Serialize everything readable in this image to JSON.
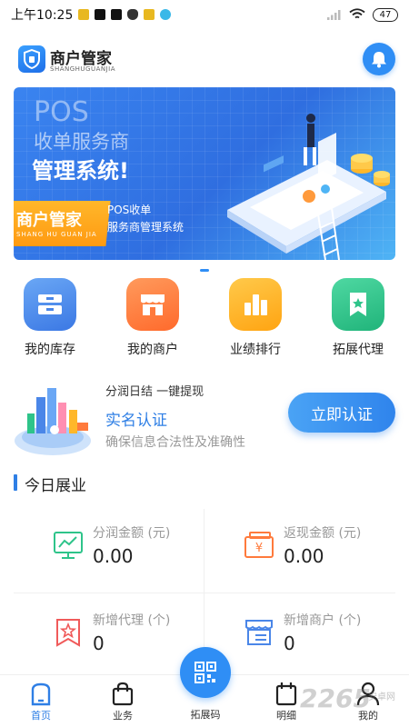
{
  "status_bar": {
    "time": "上午10:25",
    "battery": "47"
  },
  "header": {
    "title": "商户管家",
    "subtitle": "SHANGHUGUANJIA"
  },
  "banner": {
    "line1": "POS",
    "line2": "收单服务商",
    "line3": "管理系统!",
    "tag_title": "商户管家",
    "tag_subtitle": "SHANG HU GUAN JIA",
    "desc1": "POS收单",
    "desc2": "服务商管理系统"
  },
  "menu": {
    "items": [
      {
        "label": "我的库存",
        "color": "#4a86e8"
      },
      {
        "label": "我的商户",
        "color": "#ff7a3c"
      },
      {
        "label": "业绩排行",
        "color": "#ffb020"
      },
      {
        "label": "拓展代理",
        "color": "#2ec48a"
      }
    ]
  },
  "cert": {
    "top_text": "分润日结  一键提现",
    "title": "实名认证",
    "subtitle": "确保信息合法性及准确性",
    "button": "立即认证"
  },
  "section": {
    "title": "今日展业"
  },
  "stats": [
    {
      "label": "分润金额 (元)",
      "value": "0.00",
      "color": "#2ec48a"
    },
    {
      "label": "返现金额 (元)",
      "value": "0.00",
      "color": "#ff7a3c"
    },
    {
      "label": "新增代理 (个)",
      "value": "0",
      "color": "#f05a5a"
    },
    {
      "label": "新增商户 (个)",
      "value": "0",
      "color": "#4a86e8"
    }
  ],
  "nav": {
    "items": [
      "首页",
      "业务",
      "拓展码",
      "明细",
      "我的"
    ],
    "active_color": "#2f7fe5"
  },
  "watermark": {
    "text": "2265",
    "sub": "安卓网"
  }
}
